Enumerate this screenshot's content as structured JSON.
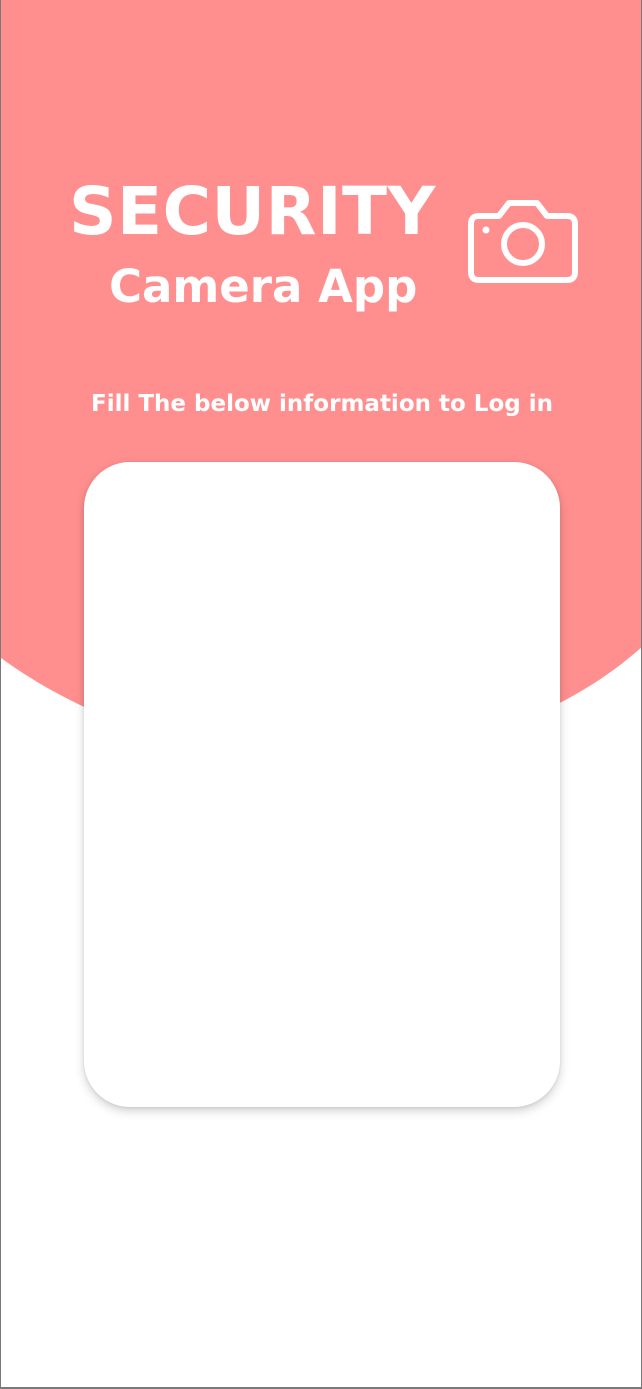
{
  "colors": {
    "accent": "#ff8f8f",
    "background": "#ffffff",
    "text_on_accent": "#ffffff"
  },
  "header": {
    "title": "SECURITY",
    "subtitle": "Camera App",
    "icon": "camera-icon"
  },
  "instruction": "Fill The below information to Log in",
  "login_card": {}
}
